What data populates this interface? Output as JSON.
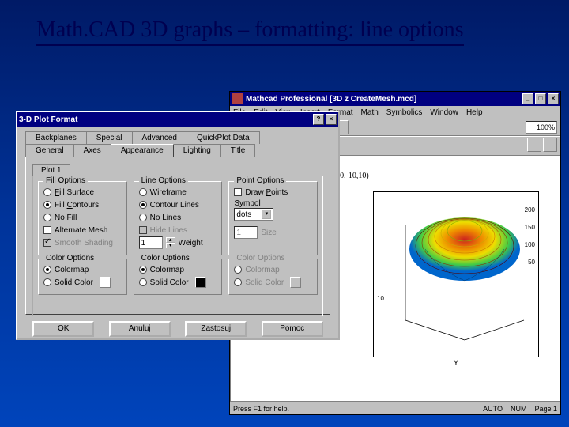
{
  "slide": {
    "title": "Math.CAD 3D graphs – formatting: line options"
  },
  "app": {
    "title": "Mathcad Professional   [3D z CreateMesh.mcd]",
    "menu": [
      "File",
      "Edit",
      "View",
      "Insert",
      "Format",
      "Math",
      "Symbolics",
      "Window",
      "Help"
    ],
    "zoom": "100%",
    "formula": "F,-10,10,-10,10)",
    "chart": {
      "ylabel": "Y",
      "ticks": [
        "200",
        "150",
        "100",
        "50",
        "10"
      ]
    },
    "status": {
      "hint": "Press F1 for help.",
      "mode": "AUTO",
      "num": "NUM",
      "page": "Page 1"
    }
  },
  "dialog": {
    "title": "3-D Plot Format",
    "tabs_row1": [
      "Backplanes",
      "Special",
      "Advanced",
      "QuickPlot Data"
    ],
    "tabs_row2": [
      "General",
      "Axes",
      "Appearance",
      "Lighting",
      "Title"
    ],
    "subtab": "Plot 1",
    "fill": {
      "legend": "Fill Options",
      "opt1": "Fill Surface",
      "opt2": "Fill Contours",
      "opt3": "No Fill",
      "chk1": "Alternate Mesh",
      "chk2": "Smooth Shading",
      "color_legend": "Color Options",
      "color1": "Colormap",
      "color2": "Solid Color"
    },
    "line": {
      "legend": "Line Options",
      "opt1": "Wireframe",
      "opt2": "Contour Lines",
      "opt3": "No Lines",
      "chk1": "Hide Lines",
      "weight_val": "1",
      "weight_lbl": "Weight",
      "color_legend": "Color Options",
      "color1": "Colormap",
      "color2": "Solid Color"
    },
    "point": {
      "legend": "Point Options",
      "chk1": "Draw Points",
      "symbol_lbl": "Symbol",
      "symbol_val": "dots",
      "size_val": "1",
      "size_lbl": "Size",
      "color_legend": "Color Options",
      "color1": "Colormap",
      "color2": "Solid Color"
    },
    "buttons": {
      "ok": "OK",
      "cancel": "Anuluj",
      "apply": "Zastosuj",
      "help": "Pomoc"
    }
  }
}
